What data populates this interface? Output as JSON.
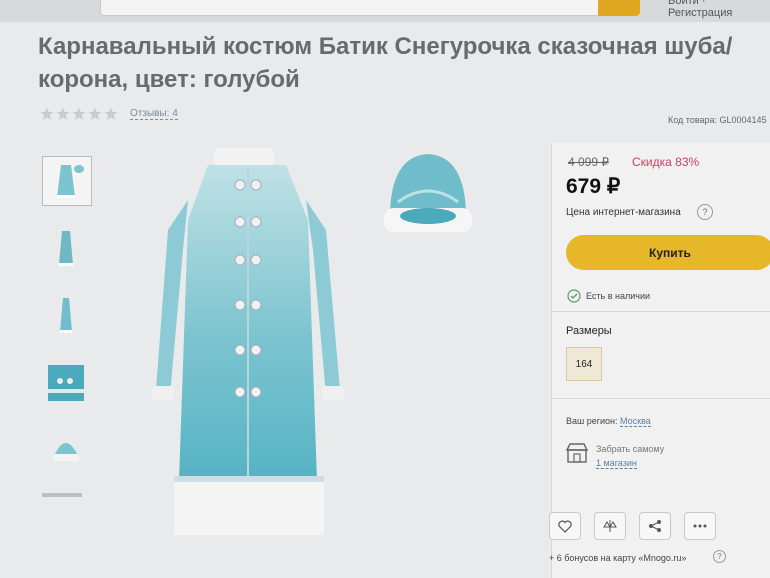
{
  "header": {
    "login_text": "Войти · Регистрация"
  },
  "product": {
    "title": "Карнавальный костюм Батик Снегурочка сказочная шуба/корона, цвет: голубой",
    "rating_stars": 5,
    "reviews_text": "Отзывы: 4",
    "code_text": "Код товара: GL0004145"
  },
  "gallery": {
    "thumbnails": [
      "coat-front",
      "coat-side",
      "coat-back",
      "fabric-detail",
      "hat"
    ],
    "main_image": "blue-coat-costume",
    "secondary_image": "blue-hat-crown"
  },
  "pricing": {
    "old_price": "4 099 ₽",
    "discount": "Скидка 83%",
    "price": "679 ₽",
    "price_label": "Цена интернет-магазина",
    "help_icon": "?",
    "buy_label": "Купить",
    "stock_text": "Есть в наличии"
  },
  "sizes": {
    "label": "Размеры",
    "options": [
      "164"
    ],
    "selected": "164"
  },
  "delivery": {
    "region_label": "Ваш регион:",
    "region_city": "Москва",
    "pickup_label": "Забрать самому",
    "pickup_link": "1 магазин"
  },
  "actions": {
    "icons": [
      "heart-icon",
      "compare-icon",
      "share-icon",
      "more-icon"
    ]
  },
  "bonus": {
    "text": "+ 6 бонусов на карту «Mnogo.ru»",
    "help": "?"
  },
  "colors": {
    "accent": "#e6b829",
    "discount": "#d33b5e",
    "link": "#5b7fa0",
    "fabric": "#7cc4cf"
  }
}
